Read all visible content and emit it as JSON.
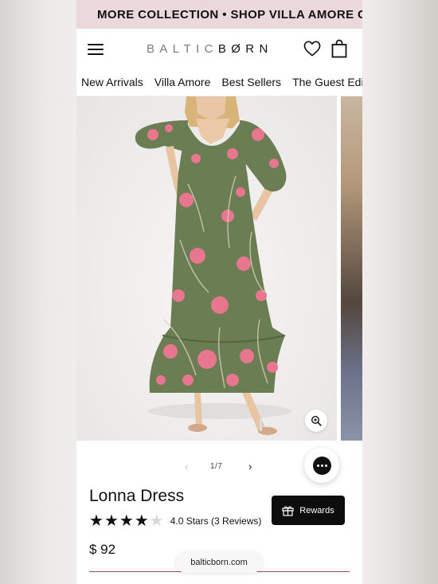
{
  "promo": {
    "text": "MORE COLLECTION • SHOP VILLA AMORE CO"
  },
  "header": {
    "logo_light": "BALTIC",
    "logo_dark": "BØRN",
    "menu_icon": "hamburger-menu-icon",
    "wishlist_icon": "heart-icon",
    "cart_icon": "shopping-bag-icon"
  },
  "nav": {
    "items": [
      "New Arrivals",
      "Villa Amore",
      "Best Sellers",
      "The Guest Edit"
    ]
  },
  "gallery": {
    "pager": "1/7",
    "zoom_icon": "zoom-in-icon"
  },
  "product": {
    "title": "Lonna Dress",
    "rating_value": 4,
    "rating_max": 5,
    "rating_text": "4.0 Stars (3 Reviews)",
    "price": "$ 92"
  },
  "rewards": {
    "label": "Rewards",
    "icon": "gift-icon"
  },
  "chat": {
    "icon": "chat-bubble-icon"
  },
  "browser": {
    "url": "balticborn.com"
  },
  "colors": {
    "promo_bg": "#ead8da",
    "dress_green": "#6b7d52",
    "flower_pink": "#e8768f",
    "button_black": "#0d0d0d"
  }
}
